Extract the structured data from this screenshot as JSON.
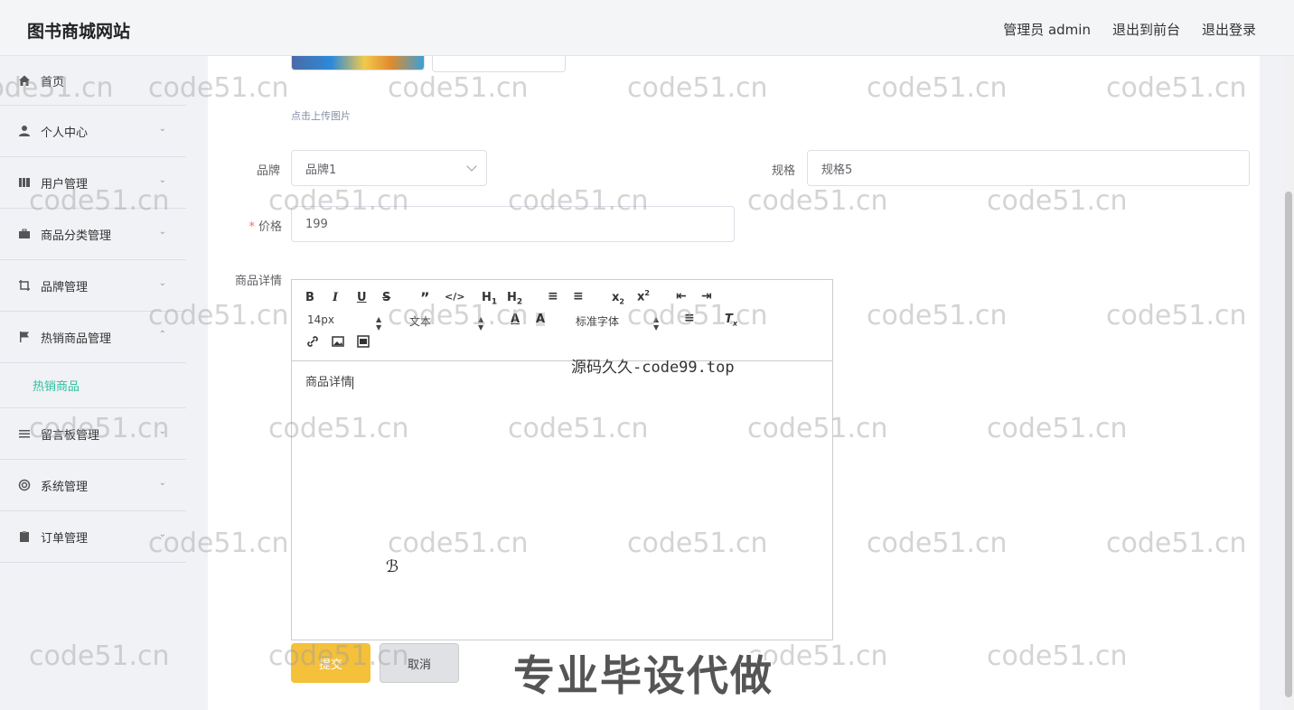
{
  "header": {
    "site_title": "图书商城网站",
    "nav": [
      "管理员 admin",
      "退出到前台",
      "退出登录"
    ]
  },
  "sidebar": {
    "items": [
      {
        "label": "首页",
        "icon": "home-icon",
        "has_chevron": false
      },
      {
        "label": "个人中心",
        "icon": "user-icon",
        "has_chevron": true
      },
      {
        "label": "用户管理",
        "icon": "book-icon",
        "has_chevron": true
      },
      {
        "label": "商品分类管理",
        "icon": "briefcase-icon",
        "has_chevron": true
      },
      {
        "label": "品牌管理",
        "icon": "crop-icon",
        "has_chevron": true
      },
      {
        "label": "热销商品管理",
        "icon": "flag-icon",
        "has_chevron": true,
        "expanded": true
      },
      {
        "label": "留言板管理",
        "icon": "list-icon",
        "has_chevron": true
      },
      {
        "label": "系统管理",
        "icon": "lifebuoy-icon",
        "has_chevron": true
      },
      {
        "label": "订单管理",
        "icon": "clipboard-icon",
        "has_chevron": true
      }
    ],
    "submenu_active": "热销商品"
  },
  "form": {
    "upload_tip": "点击上传图片",
    "brand_label": "品牌",
    "brand_value": "品牌1",
    "spec_label": "规格",
    "spec_value": "规格5",
    "price_required_mark": "*",
    "price_label": "价格",
    "price_value": "199",
    "detail_label": "商品详情",
    "editor": {
      "font_size": "14px",
      "block_type": "文本",
      "font_family": "标准字体",
      "content": "商品详情"
    },
    "submit_label": "提交",
    "cancel_label": "取消"
  },
  "watermarks": {
    "repeat_text": "code51.cn",
    "source_text": "源码久久-code99.top",
    "banner_text": "专业毕设代做"
  },
  "colors": {
    "accent": "#2fbfa0",
    "submit": "#f5c03a",
    "required": "#f56c6c"
  }
}
